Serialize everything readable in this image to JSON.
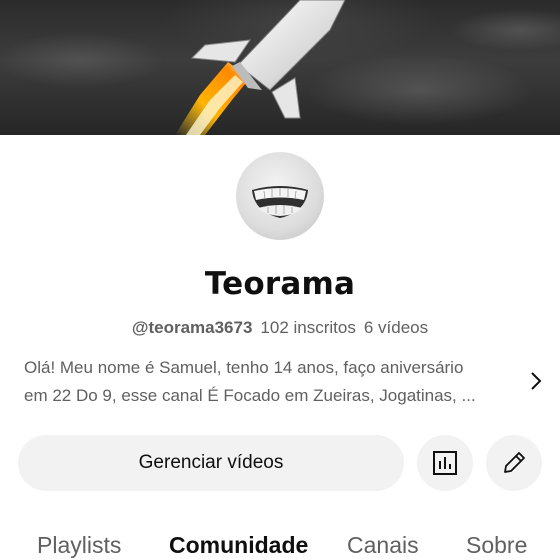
{
  "banner": {
    "image": "rocket-launch-banner"
  },
  "avatar": {
    "image": "toothy-grin-avatar"
  },
  "channel": {
    "name": "Teorama",
    "handle": "@teorama3673",
    "subscribers": "102 inscritos",
    "videos": "6 vídeos"
  },
  "description": {
    "line1": "Olá! Meu nome é Samuel, tenho 14 anos, faço aniversário",
    "line2": "em 22 Do 9, esse canal É Focado em Zueiras, Jogatinas, ..."
  },
  "actions": {
    "manage_label": "Gerenciar vídeos",
    "analytics_icon": "bar-chart-icon",
    "edit_icon": "pencil-icon"
  },
  "tabs": [
    {
      "label": "Playlists",
      "active": false
    },
    {
      "label": "Comunidade",
      "active": true
    },
    {
      "label": "Canais",
      "active": false
    },
    {
      "label": "Sobre",
      "active": false
    }
  ],
  "colors": {
    "text_primary": "#0f0f0f",
    "text_secondary": "#606060",
    "button_bg": "#f2f2f2"
  }
}
